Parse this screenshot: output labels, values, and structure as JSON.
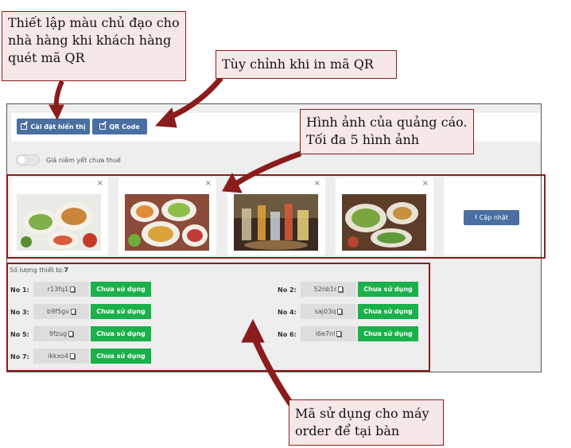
{
  "toolbar": {
    "display_settings_label": "Cài đặt hiển thị",
    "qr_code_label": "QR Code"
  },
  "price_toggle": {
    "label": "Giá niêm yết chưa thuế"
  },
  "ads": {
    "close_glyph": "×",
    "upload_label": "Cập nhật"
  },
  "devices": {
    "count_label": "Số lượng thiết bị:",
    "count_value": "7",
    "items": [
      {
        "label": "No 1:",
        "code": "r13fq1",
        "status": "Chưa sử dụng"
      },
      {
        "label": "No 2:",
        "code": "52nb1r",
        "status": "Chưa sử dụng"
      },
      {
        "label": "No 3:",
        "code": "b9f5gv",
        "status": "Chưa sử dụng"
      },
      {
        "label": "No 4:",
        "code": "saj03q",
        "status": "Chưa sử dụng"
      },
      {
        "label": "No 5:",
        "code": "9fzug",
        "status": "Chưa sử dụng"
      },
      {
        "label": "No 6:",
        "code": "i6e7nl",
        "status": "Chưa sử dụng"
      },
      {
        "label": "No 7:",
        "code": "ikkxo4",
        "status": "Chưa sử dụng"
      }
    ]
  },
  "callouts": {
    "theme_color": "Thiết lập màu chủ đạo cho nhà hàng khi khách hàng quét mã QR",
    "qr_print": "Tùy chỉnh khi in mã QR",
    "ad_images": "Hình ảnh của quảng cáo. Tối đa 5 hình ảnh",
    "device_codes": "Mã sử dụng cho máy order để tại bàn"
  },
  "colors": {
    "primary_button": "#4a6fa1",
    "status_green": "#1ab04a",
    "callout_border": "#8b1c1c",
    "callout_bg": "#f7e8e8"
  }
}
